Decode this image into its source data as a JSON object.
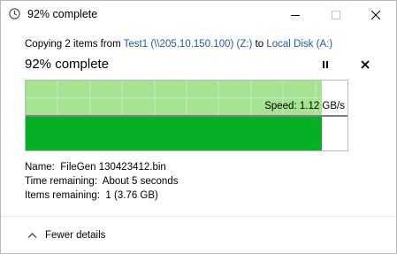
{
  "window": {
    "title": "92% complete"
  },
  "copy": {
    "prefix": "Copying 2 items from ",
    "source": "Test1 (\\\\205.10.150.100) (Z:)",
    "middle": " to ",
    "destination": "Local Disk (A:)"
  },
  "progress": {
    "title": "92% complete",
    "percent": 92,
    "speed_label": "Speed: 1.12 GB/s"
  },
  "details": {
    "name_label": "Name:",
    "name_value": "FileGen 130423412.bin",
    "time_label": "Time remaining:",
    "time_value": "About 5 seconds",
    "items_label": "Items remaining:",
    "items_value": "1 (3.76 GB)"
  },
  "footer": {
    "fewer_details": "Fewer details"
  },
  "colors": {
    "progress_green": "#06b025",
    "history_green": "#a3e392",
    "grid_line": "#c8e9bd",
    "link": "#1e5aa8"
  },
  "icons": {
    "title": "clock-icon",
    "pause": "pause-icon",
    "cancel": "close-icon",
    "fewer": "chevron-up-icon"
  }
}
